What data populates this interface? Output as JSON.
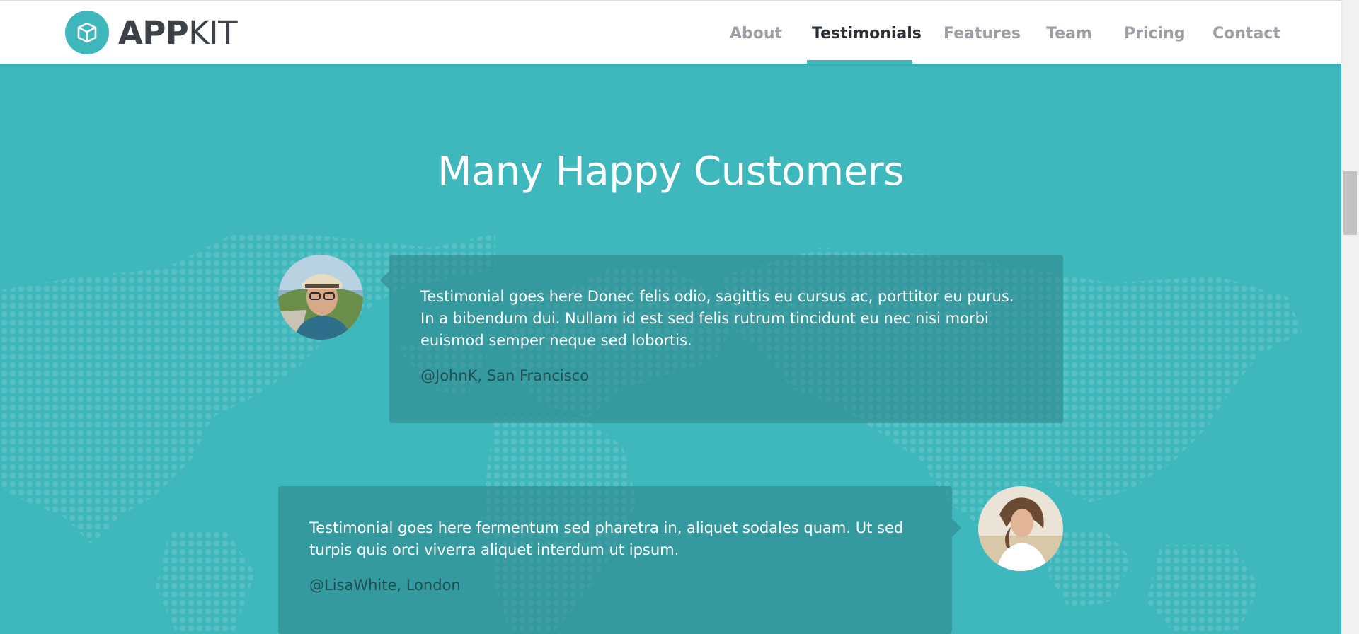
{
  "brand": {
    "bold": "APP",
    "light": "KIT",
    "logo_icon": "cube-icon"
  },
  "nav": {
    "items": [
      {
        "label": "About",
        "active": false
      },
      {
        "label": "Testimonials",
        "active": true
      },
      {
        "label": "Features",
        "active": false
      },
      {
        "label": "Team",
        "active": false
      },
      {
        "label": "Pricing",
        "active": false
      },
      {
        "label": "Contact",
        "active": false
      }
    ]
  },
  "section": {
    "title": "Many Happy Customers"
  },
  "testimonials": [
    {
      "text": "Testimonial goes here Donec felis odio, sagittis eu cursus ac, porttitor eu purus. In a bibendum dui. Nullam id est sed felis rutrum tincidunt eu nec nisi morbi euismod semper neque sed lobortis.",
      "author": "@JohnK, San Francisco",
      "avatar": "man-in-hat-avatar"
    },
    {
      "text": "Testimonial goes here fermentum sed pharetra in, aliquet sodales quam. Ut sed turpis quis orci viverra aliquet interdum ut ipsum.",
      "author": "@LisaWhite, London",
      "avatar": "woman-avatar"
    }
  ],
  "colors": {
    "accent": "#3fb8bd",
    "nav_active": "#2b3137",
    "nav_inactive": "#9aa0a6",
    "card_bg": "#2d8287"
  }
}
